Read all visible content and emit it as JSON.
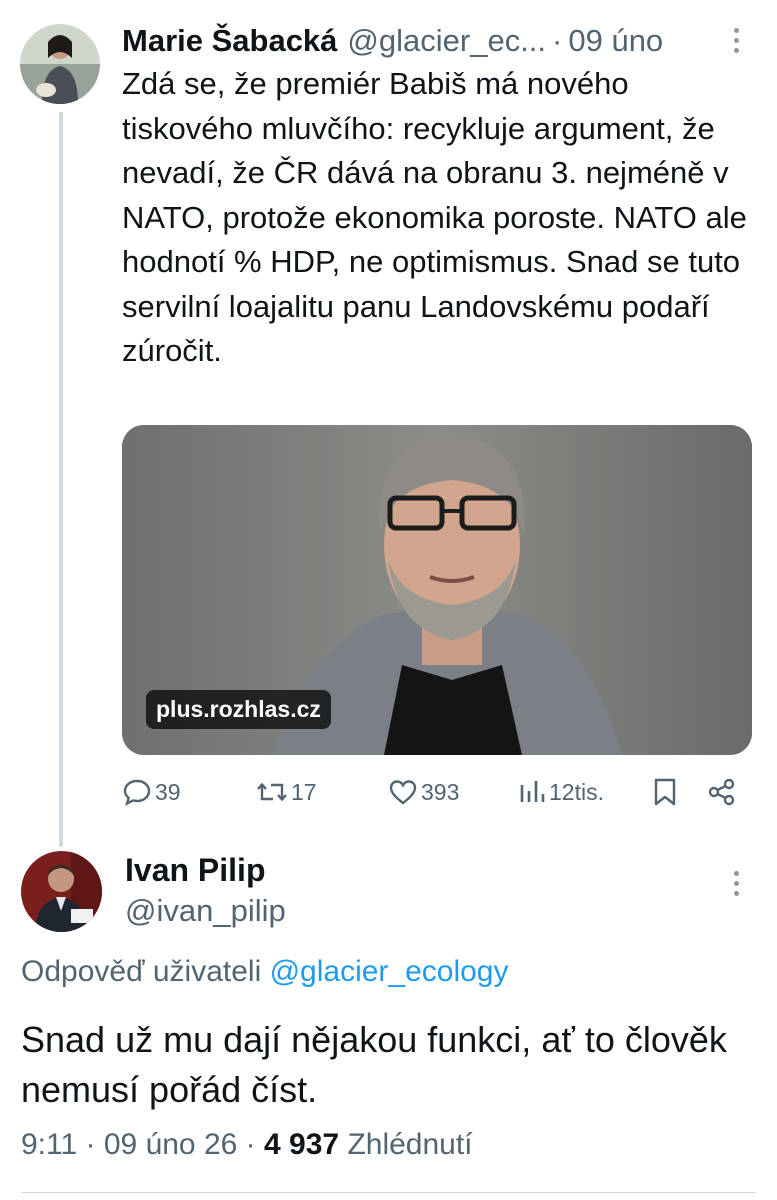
{
  "tweet1": {
    "author_name": "Marie Šabacká",
    "author_handle": "@glacier_ec...",
    "separator": "·",
    "date": "09 úno",
    "text": "Zdá se, že premiér Babiš má nového tiskového mluvčího: recykluje argument, že nevadí, že ČR dává na obranu 3. nejméně v NATO, protože ekonomika poroste. NATO ale hodnotí % HDP, ne optimismus. Snad se tuto servilní loajalitu panu Landovskému podaří zúročit.",
    "media_source": "plus.rozhlas.cz",
    "actions": {
      "replies": "39",
      "reposts": "17",
      "likes": "393",
      "views": "12tis."
    },
    "icons": [
      "reply-icon",
      "repost-icon",
      "like-icon",
      "views-icon",
      "bookmark-icon",
      "share-icon",
      "more-icon"
    ]
  },
  "tweet2": {
    "author_name": "Ivan Pilip",
    "author_handle": "@ivan_pilip",
    "reply_prefix": "Odpověď uživateli",
    "reply_to_handle": "@glacier_ecology",
    "text": "Snad už mu dají nějakou funkci, ať to člověk nemusí pořád číst.",
    "time": "9:11",
    "dot1": "·",
    "date": "09 úno 26",
    "dot2": "·",
    "views_count": "4 937",
    "views_label": "Zhlédnutí"
  },
  "colors": {
    "text_primary": "#0f1419",
    "text_secondary": "#536471",
    "link": "#1d9bf0",
    "divider": "#cfd9de"
  }
}
